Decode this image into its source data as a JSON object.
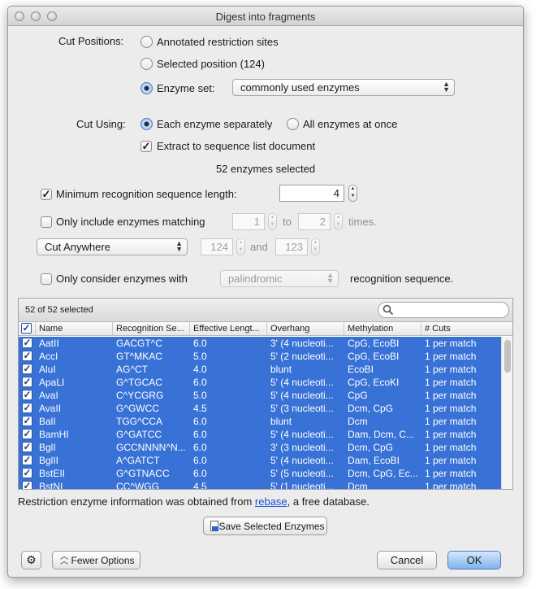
{
  "window": {
    "title": "Digest into fragments"
  },
  "cut_positions": {
    "label": "Cut Positions:",
    "opt_annotated": "Annotated restriction sites",
    "opt_selected": "Selected position (124)",
    "opt_enzyme_set": "Enzyme set:",
    "enzyme_set_value": "commonly used enzymes"
  },
  "cut_using": {
    "label": "Cut Using:",
    "opt_separately": "Each enzyme separately",
    "opt_all": "All enzymes at once",
    "extract_label": "Extract to sequence list document"
  },
  "enzymes_selected": "52 enzymes selected",
  "min_length": {
    "label": "Minimum recognition sequence length:",
    "value": "4"
  },
  "only_include": {
    "label": "Only include enzymes matching",
    "from": "1",
    "to_label": "to",
    "to": "2",
    "times_label": "times."
  },
  "cut_mode": {
    "value": "Cut Anywhere",
    "from": "124",
    "and_label": "and",
    "to": "123"
  },
  "only_consider": {
    "label": "Only consider enzymes with",
    "popup": "palindromic",
    "suffix": "recognition sequence."
  },
  "table": {
    "count_label": "52 of 52 selected",
    "search_placeholder": "",
    "columns": [
      "Name",
      "Recognition Se...",
      "Effective Lengt...",
      "Overhang",
      "Methylation",
      "# Cuts"
    ],
    "rows": [
      {
        "name": "AatII",
        "recog": "GACGT^C",
        "eff": "6.0",
        "over": "3' (4 nucleoti...",
        "meth": "CpG, EcoBI",
        "cuts": "1 per match"
      },
      {
        "name": "AccI",
        "recog": "GT^MKAC",
        "eff": "5.0",
        "over": "5' (2 nucleoti...",
        "meth": "CpG, EcoBI",
        "cuts": "1 per match"
      },
      {
        "name": "AluI",
        "recog": "AG^CT",
        "eff": "4.0",
        "over": "blunt",
        "meth": "EcoBI",
        "cuts": "1 per match"
      },
      {
        "name": "ApaLI",
        "recog": "G^TGCAC",
        "eff": "6.0",
        "over": "5' (4 nucleoti...",
        "meth": "CpG, EcoKI",
        "cuts": "1 per match"
      },
      {
        "name": "AvaI",
        "recog": "C^YCGRG",
        "eff": "5.0",
        "over": "5' (4 nucleoti...",
        "meth": "CpG",
        "cuts": "1 per match"
      },
      {
        "name": "AvaII",
        "recog": "G^GWCC",
        "eff": "4.5",
        "over": "5' (3 nucleoti...",
        "meth": "Dcm, CpG",
        "cuts": "1 per match"
      },
      {
        "name": "BalI",
        "recog": "TGG^CCA",
        "eff": "6.0",
        "over": "blunt",
        "meth": "Dcm",
        "cuts": "1 per match"
      },
      {
        "name": "BamHI",
        "recog": "G^GATCC",
        "eff": "6.0",
        "over": "5' (4 nucleoti...",
        "meth": "Dam, Dcm, C...",
        "cuts": "1 per match"
      },
      {
        "name": "BglI",
        "recog": "GCCNNNN^N...",
        "eff": "6.0",
        "over": "3' (3 nucleoti...",
        "meth": "Dcm, CpG",
        "cuts": "1 per match"
      },
      {
        "name": "BglII",
        "recog": "A^GATCT",
        "eff": "6.0",
        "over": "5' (4 nucleoti...",
        "meth": "Dam, EcoBI",
        "cuts": "1 per match"
      },
      {
        "name": "BstEII",
        "recog": "G^GTNACC",
        "eff": "6.0",
        "over": "5' (5 nucleoti...",
        "meth": "Dcm, CpG, Ec...",
        "cuts": "1 per match"
      },
      {
        "name": "BstNI",
        "recog": "CC^WGG",
        "eff": "4.5",
        "over": "5' (1 nucleoti...",
        "meth": "Dcm",
        "cuts": "1 per match"
      }
    ]
  },
  "info": {
    "prefix": "Restriction enzyme information was obtained from ",
    "link": "rebase",
    "suffix": ", a free database."
  },
  "buttons": {
    "save_selected": "Save Selected Enzymes",
    "fewer_options": "Fewer Options",
    "cancel": "Cancel",
    "ok": "OK"
  },
  "colors": {
    "selection": "#3872d6",
    "link": "#1a4fd6"
  }
}
